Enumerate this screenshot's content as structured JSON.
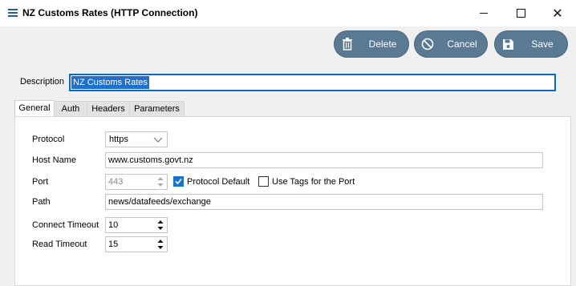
{
  "window": {
    "title": "NZ Customs Rates (HTTP Connection)",
    "controls": {
      "minimize": "minimize-icon",
      "maximize": "maximize-icon",
      "close": "close-icon"
    }
  },
  "toolbar": {
    "delete_label": "Delete",
    "cancel_label": "Cancel",
    "save_label": "Save",
    "button_color": "#5a7a93"
  },
  "description": {
    "label": "Description",
    "value": "NZ Customs Rates"
  },
  "tabs": [
    {
      "label": "General",
      "active": true
    },
    {
      "label": "Auth",
      "active": false
    },
    {
      "label": "Headers",
      "active": false
    },
    {
      "label": "Parameters",
      "active": false
    }
  ],
  "form": {
    "protocol": {
      "label": "Protocol",
      "value": "https"
    },
    "host": {
      "label": "Host Name",
      "value": "www.customs.govt.nz"
    },
    "port": {
      "label": "Port",
      "value": "443",
      "protocol_default_label": "Protocol Default",
      "protocol_default_checked": true,
      "use_tags_label": "Use Tags for the Port",
      "use_tags_checked": false
    },
    "path": {
      "label": "Path",
      "value": "news/datafeeds/exchange"
    },
    "connect_timeout": {
      "label": "Connect Timeout",
      "value": "10"
    },
    "read_timeout": {
      "label": "Read Timeout",
      "value": "15"
    }
  }
}
